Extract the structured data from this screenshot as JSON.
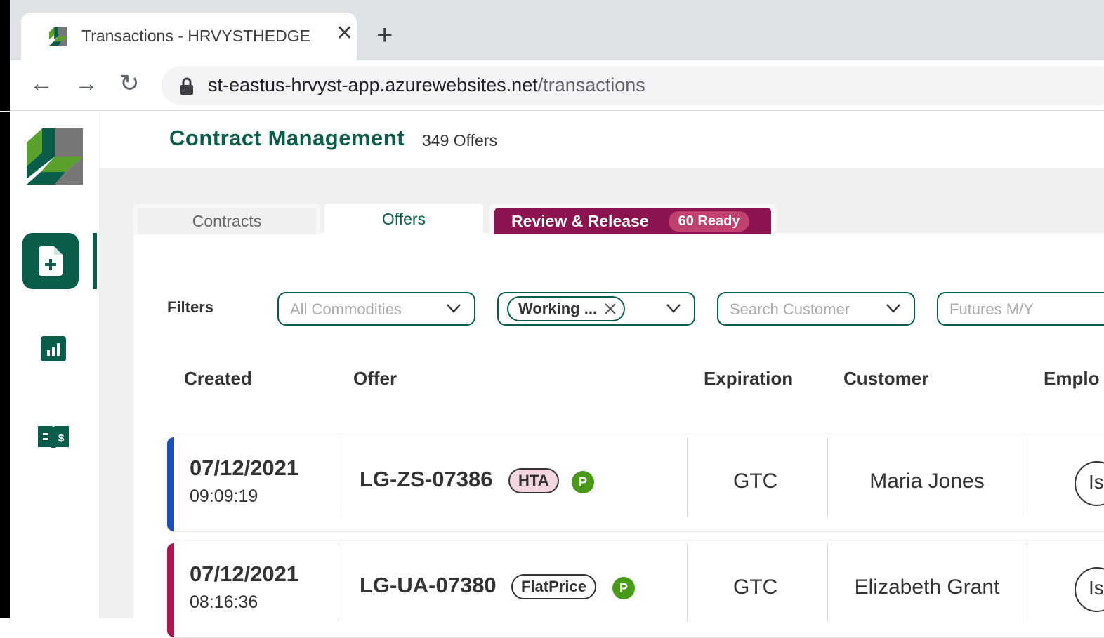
{
  "browser": {
    "tab_title": "Transactions - HRVYSTHEDGE",
    "url_host": "st-eastus-hrvyst-app.azurewebsites.net",
    "url_path": "/transactions"
  },
  "header": {
    "title": "Contract Management",
    "count": "349 Offers"
  },
  "tabs": {
    "contracts": "Contracts",
    "offers": "Offers",
    "review": "Review & Release",
    "review_badge": "60 Ready"
  },
  "filters": {
    "label": "Filters",
    "commodities_placeholder": "All Commodities",
    "status_chip": "Working ...",
    "customer_placeholder": "Search Customer",
    "futures_placeholder": "Futures M/Y"
  },
  "table": {
    "columns": [
      "Created",
      "Offer",
      "Expiration",
      "Customer",
      "Emplo"
    ],
    "rows": [
      {
        "date": "07/12/2021",
        "time": "09:09:19",
        "offer": "LG-ZS-07386",
        "type": "HTA",
        "badge": "P",
        "expiration": "GTC",
        "customer": "Maria Jones",
        "employee_initials": "Is",
        "bar_color": "#1b4fbf",
        "pill_color": "#f3d6e0"
      },
      {
        "date": "07/12/2021",
        "time": "08:16:36",
        "offer": "LG-UA-07380",
        "type": "FlatPrice",
        "badge": "P",
        "expiration": "GTC",
        "customer": "Elizabeth Grant",
        "employee_initials": "Is",
        "bar_color": "#b0154f",
        "pill_color": "#ffffff"
      }
    ]
  },
  "colors": {
    "brand": "#0a5c4b",
    "review": "#8b1450",
    "badge_green": "#4a9a1a"
  }
}
